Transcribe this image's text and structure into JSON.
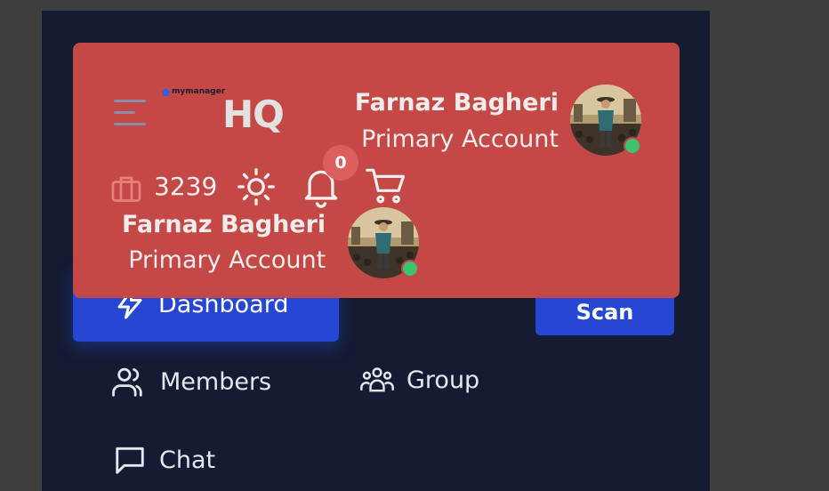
{
  "header": {
    "logo_small": "mymanager",
    "logo_big": "HQ",
    "user": {
      "name": "Farnaz Bagheri",
      "account_type": "Primary Account"
    },
    "points": "3239",
    "notification_count": "0"
  },
  "nav": {
    "dashboard": "Dashboard",
    "members": "Members",
    "group": "Group",
    "chat": "Chat",
    "scan": "Scan"
  },
  "colors": {
    "header_bg": "#c44846",
    "panel_bg": "#151b32",
    "accent": "#2547d4",
    "online": "#3ec46d"
  }
}
